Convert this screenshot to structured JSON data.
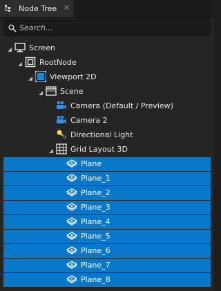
{
  "tab": {
    "title": "Node Tree",
    "close_glyph": "✕",
    "icon": "tree-icon"
  },
  "search": {
    "placeholder": "Search...",
    "value": ""
  },
  "tree": {
    "items": [
      {
        "label": "Screen",
        "icon": "monitor-icon",
        "depth": 0,
        "expanded": true,
        "selected": false
      },
      {
        "label": "RootNode",
        "icon": "root-node-icon",
        "depth": 1,
        "expanded": true,
        "selected": false
      },
      {
        "label": "Viewport 2D",
        "icon": "viewport-icon",
        "depth": 2,
        "expanded": true,
        "selected": false
      },
      {
        "label": "Scene",
        "icon": "scene-icon",
        "depth": 3,
        "expanded": true,
        "selected": false
      },
      {
        "label": "Camera (Default / Preview)",
        "icon": "camera-icon",
        "depth": 4,
        "expanded": false,
        "selected": false
      },
      {
        "label": "Camera 2",
        "icon": "camera-icon",
        "depth": 4,
        "expanded": false,
        "selected": false
      },
      {
        "label": "Directional Light",
        "icon": "light-icon",
        "depth": 4,
        "expanded": false,
        "selected": false
      },
      {
        "label": "Grid Layout 3D",
        "icon": "grid-layout-icon",
        "depth": 4,
        "expanded": true,
        "selected": false
      },
      {
        "label": "Plane",
        "icon": "plane-icon",
        "depth": 5,
        "expanded": false,
        "selected": true
      },
      {
        "label": "Plane_1",
        "icon": "plane-icon",
        "depth": 5,
        "expanded": false,
        "selected": true
      },
      {
        "label": "Plane_2",
        "icon": "plane-icon",
        "depth": 5,
        "expanded": false,
        "selected": true
      },
      {
        "label": "Plane_3",
        "icon": "plane-icon",
        "depth": 5,
        "expanded": false,
        "selected": true
      },
      {
        "label": "Plane_4",
        "icon": "plane-icon",
        "depth": 5,
        "expanded": false,
        "selected": true
      },
      {
        "label": "Plane_5",
        "icon": "plane-icon",
        "depth": 5,
        "expanded": false,
        "selected": true
      },
      {
        "label": "Plane_6",
        "icon": "plane-icon",
        "depth": 5,
        "expanded": false,
        "selected": true
      },
      {
        "label": "Plane_7",
        "icon": "plane-icon",
        "depth": 5,
        "expanded": false,
        "selected": true
      },
      {
        "label": "Plane_8",
        "icon": "plane-icon",
        "depth": 5,
        "expanded": false,
        "selected": true
      }
    ]
  },
  "colors": {
    "selection": "#0a78c8",
    "background": "#252526"
  }
}
